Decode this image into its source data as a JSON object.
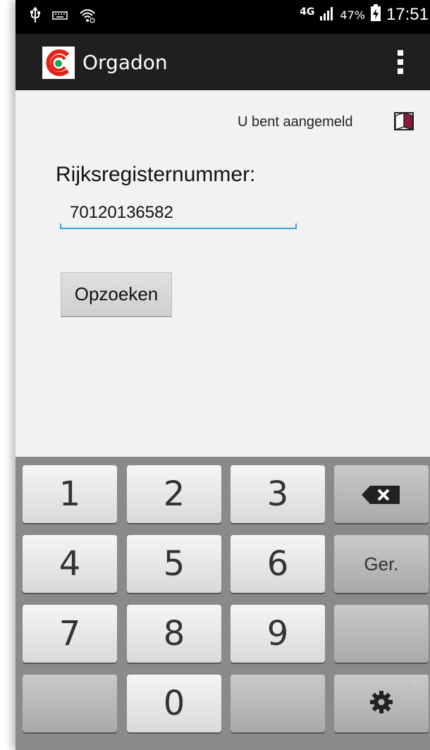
{
  "status_bar": {
    "icons": [
      "usb-icon",
      "keyboard-icon",
      "wifi-icon",
      "signal-icon",
      "battery-charging-icon"
    ],
    "network": "4G",
    "battery_percent": "47%",
    "time": "17:51"
  },
  "action_bar": {
    "title": "Orgadon",
    "icons": [
      "app-logo-icon",
      "overflow-menu-icon"
    ]
  },
  "main": {
    "login_status": "U bent aangemeld",
    "field_label": "Rijksregisternummer:",
    "field_value": "70120136582",
    "lookup_button": "Opzoeken"
  },
  "keyboard": {
    "keys": [
      "1",
      "2",
      "3",
      "4",
      "5",
      "6",
      "7",
      "8",
      "9",
      "0"
    ],
    "go_label": "Ger.",
    "icons": [
      "backspace-icon",
      "settings-gear-icon"
    ],
    "more_indicator": "..."
  },
  "colors": {
    "action_bar": "#1f1f1f",
    "field_underline": "#33a5d4",
    "logo_red": "#e2231a",
    "logo_green": "#1aa64a"
  }
}
